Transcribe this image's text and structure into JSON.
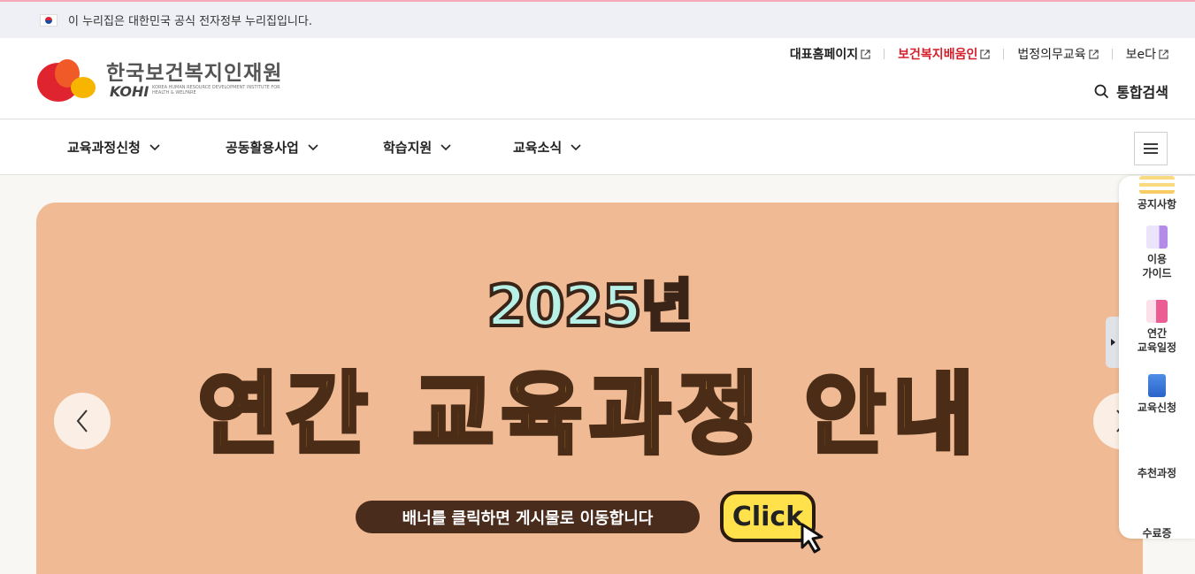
{
  "gov_banner": {
    "text": "이 누리집은 대한민국 공식 전자정부 누리집입니다."
  },
  "logo": {
    "name_ko": "한국보건복지인재원",
    "name_en": "KOHI",
    "subtitle": "KOREA HUMAN RESOURCE DEVELOPMENT INSTITUTE FOR HEALTH & WELFARE"
  },
  "util_links": [
    {
      "label": "대표홈페이지"
    },
    {
      "label": "보건복지배움인"
    },
    {
      "label": "법정의무교육"
    },
    {
      "label": "보e다"
    }
  ],
  "search": {
    "label": "통합검색"
  },
  "nav": [
    {
      "label": "교육과정신청"
    },
    {
      "label": "공동활용사업"
    },
    {
      "label": "학습지원"
    },
    {
      "label": "교육소식"
    }
  ],
  "banner": {
    "year": "2025년",
    "title": "연간 교육과정 안내",
    "subtitle": "배너를 클릭하면 게시물로 이동합니다",
    "click_label": "Click",
    "background": "#f0bb94"
  },
  "quick_menu": [
    {
      "label": "공지사항",
      "icon": "notice-icon"
    },
    {
      "label": "이용\n가이드",
      "icon": "guide-icon"
    },
    {
      "label": "연간\n교육일정",
      "icon": "calendar-icon"
    },
    {
      "label": "교육신청",
      "icon": "apply-icon"
    },
    {
      "label": "추천과정",
      "icon": "recommend-icon"
    },
    {
      "label": "수료증",
      "icon": "certificate-icon"
    }
  ],
  "colors": {
    "accent_red": "#d41f2b",
    "banner_bg": "#f0bb94"
  }
}
